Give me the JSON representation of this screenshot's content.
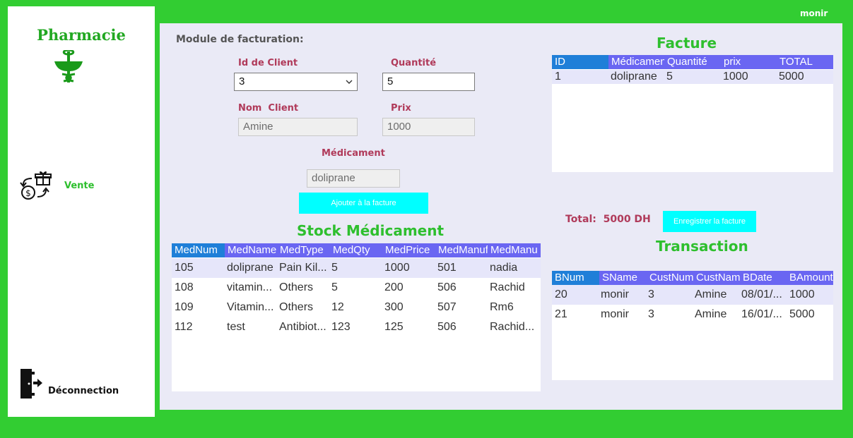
{
  "app": {
    "user": "monir",
    "brand": "Pharmacie"
  },
  "sidebar": {
    "vente_label": "Vente",
    "logout_label": "Déconnection"
  },
  "billing": {
    "module_title": "Module de facturation:",
    "client_id_label": "Id de Client",
    "client_id_value": "3",
    "quantity_label": "Quantité",
    "quantity_value": "5",
    "client_name_label": "Nom  Client",
    "client_name_value": "Amine",
    "price_label": "Prix",
    "price_value": "1000",
    "medication_label": "Médicament",
    "medication_value": "doliprane",
    "add_button": "Ajouter à la facture"
  },
  "stock": {
    "title": "Stock Médicament",
    "columns": [
      "MedNum",
      "MedName",
      "MedType",
      "MedQty",
      "MedPrice",
      "MedManuf",
      "MedManu"
    ],
    "rows": [
      [
        "105",
        "doliprane",
        "Pain Kil...",
        "5",
        "1000",
        "501",
        "nadia"
      ],
      [
        "108",
        "vitamin...",
        "Others",
        "5",
        "200",
        "506",
        "Rachid"
      ],
      [
        "109",
        "Vitamin...",
        "Others",
        "12",
        "300",
        "507",
        "Rm6"
      ],
      [
        "112",
        "test",
        "Antibiot...",
        "123",
        "125",
        "506",
        "Rachid..."
      ]
    ]
  },
  "facture": {
    "title": "Facture",
    "columns": [
      "ID",
      "Médicament",
      "Quantité",
      "prix",
      "TOTAL"
    ],
    "rows": [
      [
        "1",
        "doliprane",
        "5",
        "1000",
        "5000"
      ]
    ]
  },
  "total": {
    "label": "Total:  5000 DH",
    "save_button": "Enregistrer la facture"
  },
  "transaction": {
    "title": "Transaction",
    "columns": [
      "BNum",
      "SName",
      "CustNum",
      "CustName",
      "BDate",
      "BAmount"
    ],
    "rows": [
      [
        "20",
        "monir",
        "3",
        "Amine",
        "08/01/...",
        "1000"
      ],
      [
        "21",
        "monir",
        "3",
        "Amine",
        "16/01/...",
        "5000"
      ]
    ]
  },
  "colors": {
    "background": "#32cd32",
    "accent_button": "#00ffff",
    "header_blue": "#6a66f2",
    "label_red": "#b03a5a",
    "title_green": "#2ebf2e"
  }
}
